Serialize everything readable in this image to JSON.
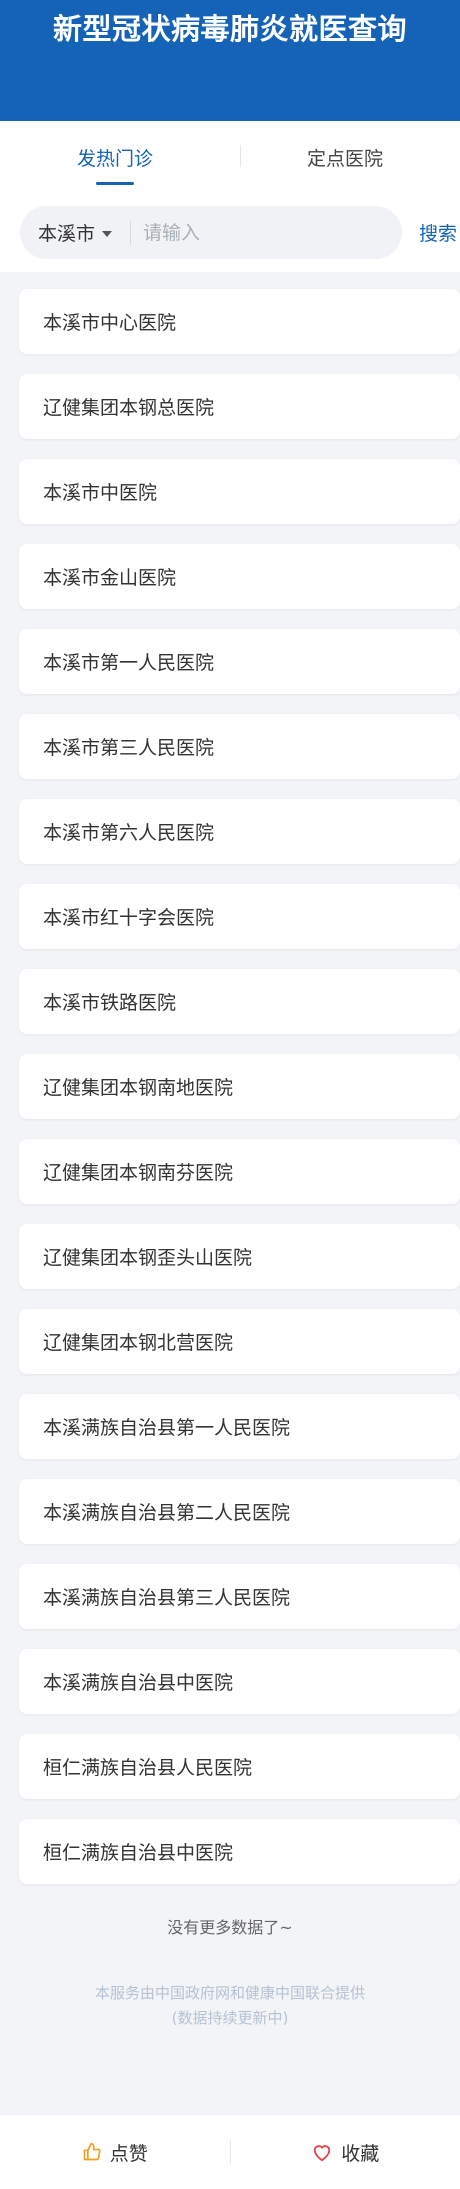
{
  "header": {
    "title": "新型冠状病毒肺炎就医查询"
  },
  "tabs": [
    {
      "label": "发热门诊",
      "active": true
    },
    {
      "label": "定点医院",
      "active": false
    }
  ],
  "search": {
    "city": "本溪市",
    "placeholder": "请输入",
    "value": "",
    "button_label": "搜索"
  },
  "hospitals": [
    "本溪市中心医院",
    "辽健集团本钢总医院",
    "本溪市中医院",
    "本溪市金山医院",
    "本溪市第一人民医院",
    "本溪市第三人民医院",
    "本溪市第六人民医院",
    "本溪市红十字会医院",
    "本溪市铁路医院",
    "辽健集团本钢南地医院",
    "辽健集团本钢南芬医院",
    "辽健集团本钢歪头山医院",
    "辽健集团本钢北营医院",
    "本溪满族自治县第一人民医院",
    "本溪满族自治县第二人民医院",
    "本溪满族自治县第三人民医院",
    "本溪满族自治县中医院",
    "桓仁满族自治县人民医院",
    "桓仁满族自治县中医院"
  ],
  "status": {
    "no_more": "没有更多数据了~"
  },
  "footer": {
    "line1": "本服务由中国政府网和健康中国联合提供",
    "line2": "(数据持续更新中)"
  },
  "bottom_bar": {
    "like_label": "点赞",
    "like_icon": "thumbs-up-icon",
    "favorite_label": "收藏",
    "favorite_icon": "heart-icon"
  },
  "colors": {
    "brand": "#1463b6",
    "accent_icon": "#f0a020",
    "heart": "#e0474c"
  }
}
